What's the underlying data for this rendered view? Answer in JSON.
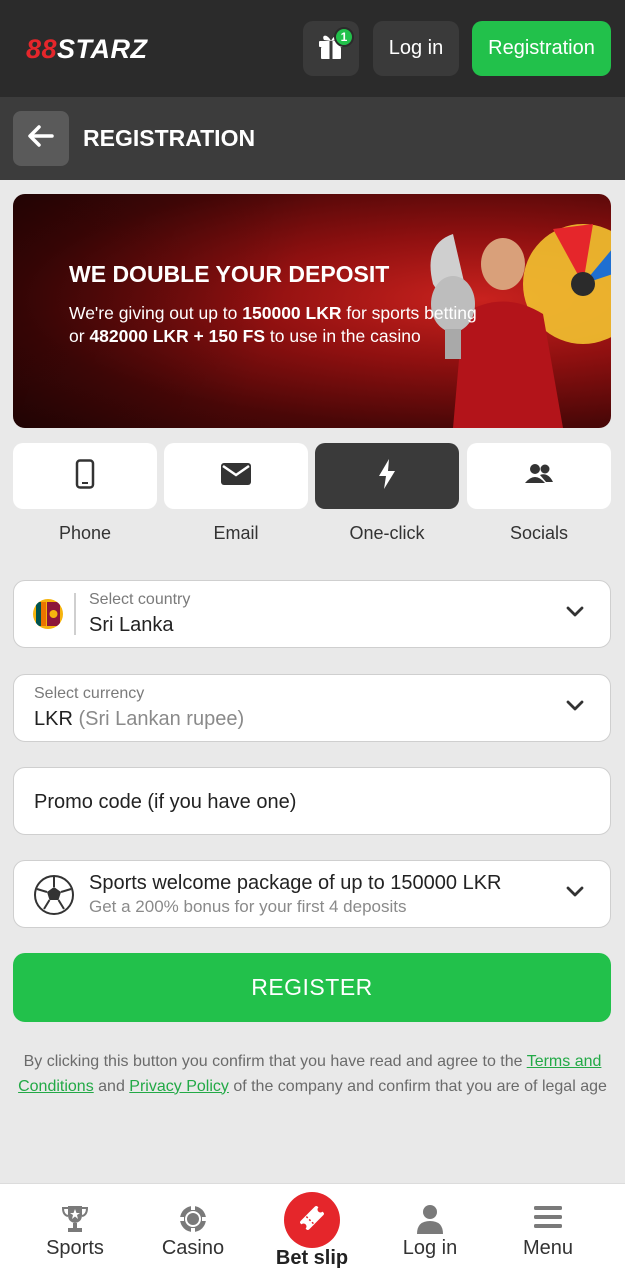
{
  "header": {
    "logo_prefix": "88",
    "logo_text": "STARZ",
    "gift_count": "1",
    "login_label": "Log in",
    "registration_label": "Registration"
  },
  "titlebar": {
    "title": "REGISTRATION"
  },
  "banner": {
    "title": "WE DOUBLE YOUR DEPOSIT",
    "line1_a": "We're giving out up to ",
    "line1_b": "150000 LKR",
    "line1_c": " for sports betting",
    "line2_a": "or ",
    "line2_b": "482000 LKR + 150 FS",
    "line2_c": " to use in the casino"
  },
  "tabs": [
    {
      "label": "Phone",
      "icon": "phone-icon",
      "active": false
    },
    {
      "label": "Email",
      "icon": "envelope-icon",
      "active": false
    },
    {
      "label": "One-click",
      "icon": "lightning-icon",
      "active": true
    },
    {
      "label": "Socials",
      "icon": "people-icon",
      "active": false
    }
  ],
  "form": {
    "country_label": "Select country",
    "country_value": "Sri Lanka",
    "currency_label": "Select currency",
    "currency_code": "LKR",
    "currency_name": "(Sri Lankan rupee)",
    "promo_placeholder": "Promo code (if you have one)",
    "bonus_title": "Sports welcome package of up to 150000 LKR",
    "bonus_subtitle": "Get a 200% bonus for your first 4 deposits",
    "register_label": "REGISTER"
  },
  "disclaimer": {
    "text_a": "By clicking this button you confirm that you have read and agree to the ",
    "terms_link": "Terms and Conditions",
    "text_b": " and ",
    "privacy_link": "Privacy Policy",
    "text_c": " of the company and confirm that you are of legal age"
  },
  "bottom_nav": {
    "sports": "Sports",
    "casino": "Casino",
    "bet_slip": "Bet slip",
    "login": "Log in",
    "menu": "Menu"
  },
  "colors": {
    "accent_green": "#22c14b",
    "brand_red": "#e5262b",
    "header_bg": "#2b2b2b"
  }
}
